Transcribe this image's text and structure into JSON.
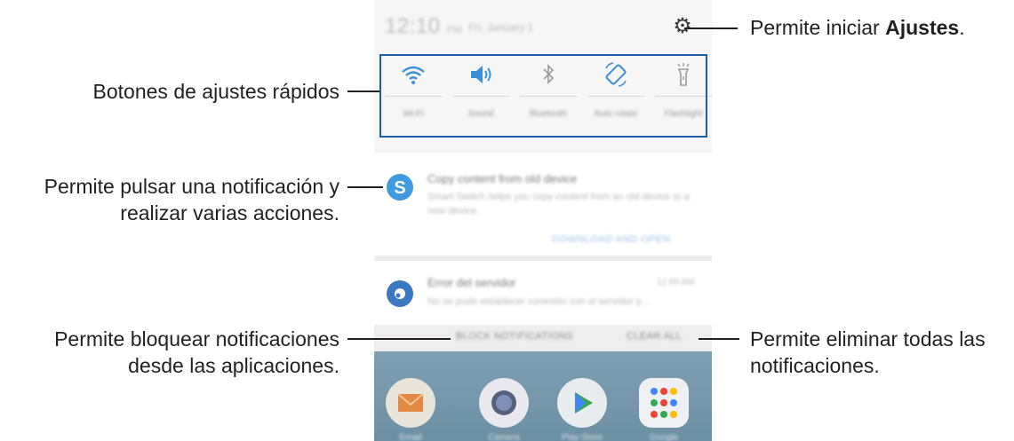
{
  "phone": {
    "status": {
      "time": "12:10",
      "ampm": "PM",
      "date": "Fri, January 1"
    },
    "quick_settings": [
      {
        "label": "Wi-Fi",
        "icon": "wifi-icon",
        "color": "#3b8fd6"
      },
      {
        "label": "Sound",
        "icon": "speaker-icon",
        "color": "#3b8fd6"
      },
      {
        "label": "Bluetooth",
        "icon": "bluetooth-icon",
        "color": "#9a9a9a"
      },
      {
        "label": "Auto rotate",
        "icon": "rotate-icon",
        "color": "#3b8fd6"
      },
      {
        "label": "Flashlight",
        "icon": "flashlight-icon",
        "color": "#9a9a9a"
      }
    ],
    "notifications": [
      {
        "title": "Copy content from old device",
        "text": "Smart Switch helps you copy content from an old device to a new device.",
        "action": "DOWNLOAD AND OPEN",
        "icon": "smart-switch-icon",
        "icon_color": "#3f9ae0"
      },
      {
        "title": "Error del servidor",
        "text": "No se pudo establecer conexión con el servidor p...",
        "time": "12:00 AM",
        "icon": "music-icon",
        "icon_color": "#3a78c2"
      }
    ],
    "bottom_bar": {
      "block": "BLOCK NOTIFICATIONS",
      "clear": "CLEAR ALL"
    },
    "home_apps": [
      {
        "label": "Email",
        "icon": "email-icon"
      },
      {
        "label": "Camera",
        "icon": "camera-icon"
      },
      {
        "label": "Play Store",
        "icon": "play-store-icon"
      },
      {
        "label": "Google",
        "icon": "google-folder-icon"
      }
    ]
  },
  "callouts": {
    "settings_prefix": "Permite iniciar ",
    "settings_bold": "Ajustes",
    "settings_suffix": ".",
    "quick_settings": "Botones de ajustes rápidos",
    "notification_line1": "Permite pulsar una notificación y",
    "notification_line2": "realizar varias acciones.",
    "block_line1": "Permite bloquear notificaciones",
    "block_line2": "desde las aplicaciones.",
    "clear_line1": "Permite eliminar todas las",
    "clear_line2": "notificaciones."
  },
  "colors": {
    "highlight": "#1a5ea8",
    "text": "#231f20"
  }
}
